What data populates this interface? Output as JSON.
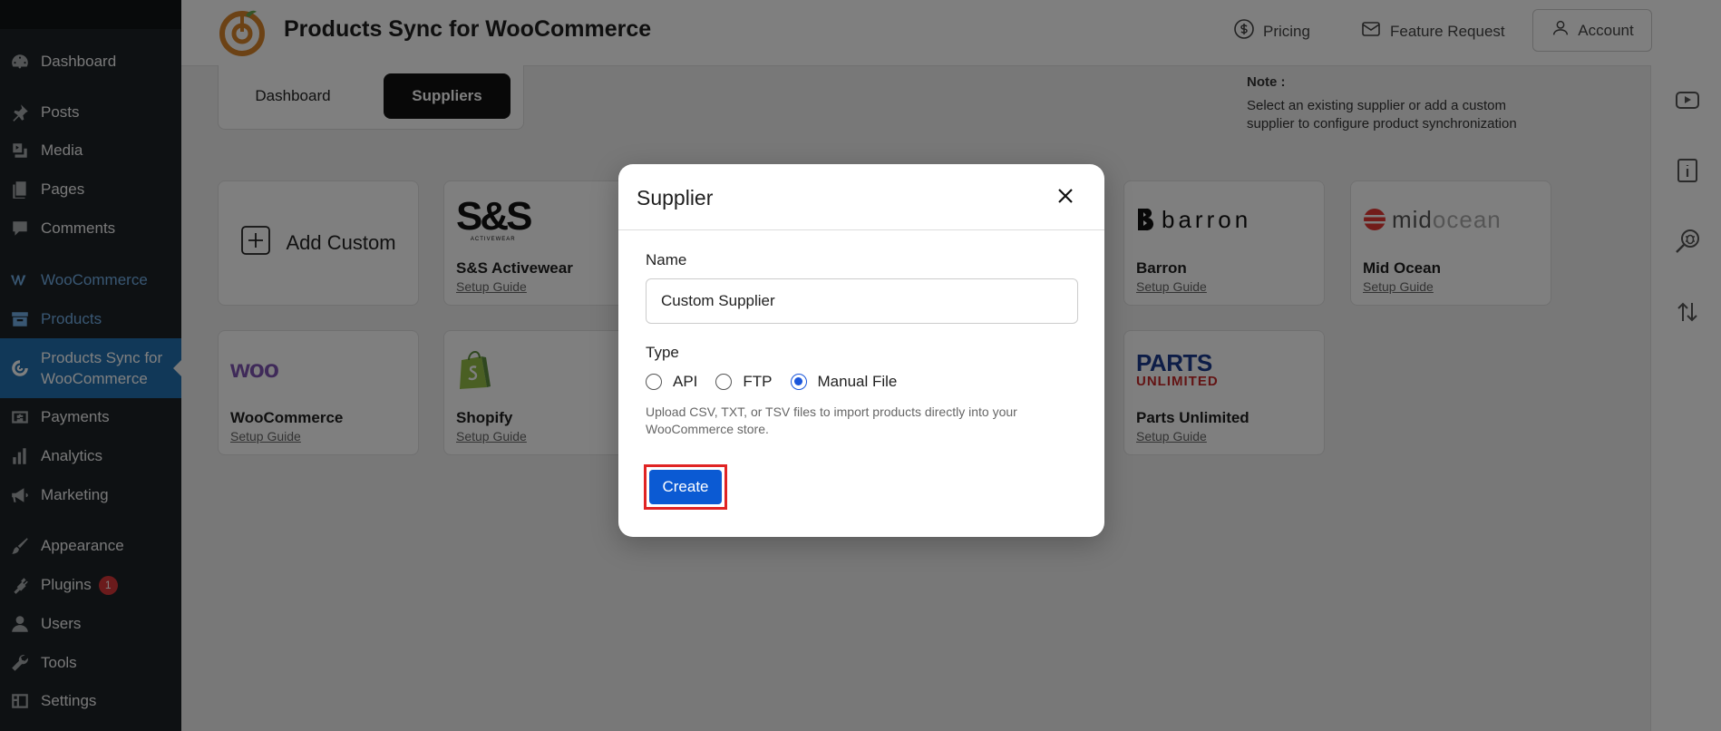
{
  "sidebar": {
    "items": [
      {
        "label": "Dashboard",
        "icon": "dashboard-icon"
      },
      {
        "label": "Posts",
        "icon": "pin-icon"
      },
      {
        "label": "Media",
        "icon": "media-icon"
      },
      {
        "label": "Pages",
        "icon": "pages-icon"
      },
      {
        "label": "Comments",
        "icon": "comment-icon"
      },
      {
        "label": "WooCommerce",
        "icon": "woo-icon"
      },
      {
        "label": "Products",
        "icon": "archive-icon"
      },
      {
        "label": "Products Sync for WooCommerce",
        "icon": "sync-logo-icon"
      },
      {
        "label": "Payments",
        "icon": "dollar-icon"
      },
      {
        "label": "Analytics",
        "icon": "bar-chart-icon"
      },
      {
        "label": "Marketing",
        "icon": "megaphone-icon"
      },
      {
        "label": "Appearance",
        "icon": "brush-icon"
      },
      {
        "label": "Plugins",
        "icon": "plug-icon",
        "badge": "1"
      },
      {
        "label": "Users",
        "icon": "user-icon"
      },
      {
        "label": "Tools",
        "icon": "wrench-icon"
      },
      {
        "label": "Settings",
        "icon": "settings-icon"
      }
    ]
  },
  "header": {
    "title": "Products Sync for WooCommerce",
    "pricing": "Pricing",
    "feature_request": "Feature Request",
    "account": "Account"
  },
  "tabs": {
    "dashboard": "Dashboard",
    "suppliers": "Suppliers"
  },
  "note": {
    "title": "Note :",
    "body": "Select an existing supplier or add a custom supplier to configure product synchronization"
  },
  "cards": {
    "add_custom": "Add Custom",
    "setup_guide": "Setup Guide",
    "ss": "S&S Activewear",
    "barron": "Barron",
    "midocean": "Mid Ocean",
    "woocommerce": "WooCommerce",
    "shopify": "Shopify",
    "parts": "Parts Unlimited",
    "logos": {
      "ss_main": "S&S",
      "ss_sub": "ACTIVEWEAR",
      "barron": "barron",
      "mid": "mid",
      "ocean": "ocean",
      "woo": "woo",
      "parts_top": "PARTS",
      "parts_bottom": "UNLIMITED"
    }
  },
  "modal": {
    "title": "Supplier",
    "name_label": "Name",
    "name_value": "Custom Supplier",
    "type_label": "Type",
    "types": [
      "API",
      "FTP",
      "Manual File"
    ],
    "selected_type": "Manual File",
    "help": "Upload CSV, TXT, or TSV files to import products directly into your WooCommerce store.",
    "create": "Create"
  },
  "colors": {
    "sidebar_bg": "#1d2327",
    "active_bg": "#2271b1",
    "accent_blue": "#0b5ad3",
    "highlight_red": "#e02424",
    "logo_orange": "#d9852b"
  }
}
